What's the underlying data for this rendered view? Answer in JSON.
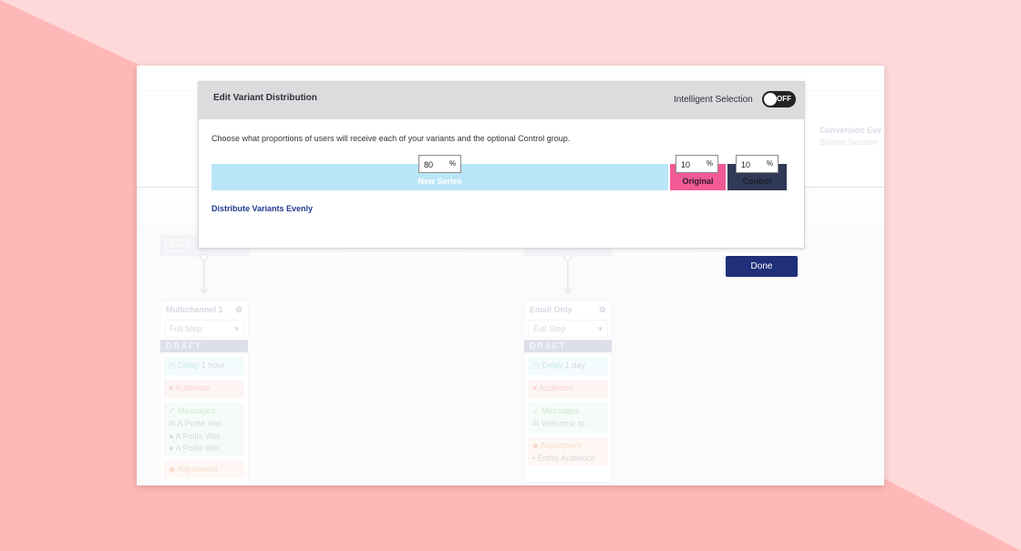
{
  "background": {
    "light": "#ffd9d9",
    "dark": "#ffb8b8"
  },
  "app": {
    "conversion_event": {
      "title": "Conversion Eve",
      "subtitle": "Started Session"
    },
    "done_label": "Done",
    "branches": [
      {
        "percent_tag": "80%",
        "step_title": "Multichannel 1",
        "step_select": "Full Step",
        "status": "DRAFT",
        "delay_label": "Delay",
        "delay_value": "1 hour",
        "audience_label": "Audience",
        "messages_label": "Messages",
        "messages": [
          "A Polite Wel...",
          "A Polite Wel...",
          "A Polite Wel..."
        ],
        "adjustment_label": "Adjustment"
      },
      {
        "percent_tag": "",
        "step_title": "Email Only",
        "step_select": "Full Step",
        "status": "DRAFT",
        "delay_label": "Delay",
        "delay_value": "1 day",
        "audience_label": "Audience",
        "messages_label": "Messages",
        "messages": [
          "Welcome to ..."
        ],
        "adjustment_label": "Adjustment",
        "adjustment_items": [
          "Entire Audience"
        ]
      }
    ]
  },
  "modal": {
    "title": "Edit Variant Distribution",
    "intelligent_selection_label": "Intelligent Selection",
    "toggle_state": "OFF",
    "description": "Choose what proportions of users will receive each of your variants and the optional Control group.",
    "variants": [
      {
        "name": "New Series",
        "percent": 80,
        "color": "#b9e6f7"
      },
      {
        "name": "Original",
        "percent": 10,
        "color": "#f25a95"
      },
      {
        "name": "Control",
        "percent": 10,
        "color": "#303a56"
      }
    ],
    "percent_symbol": "%",
    "distribute_link": "Distribute Variants Evenly"
  }
}
